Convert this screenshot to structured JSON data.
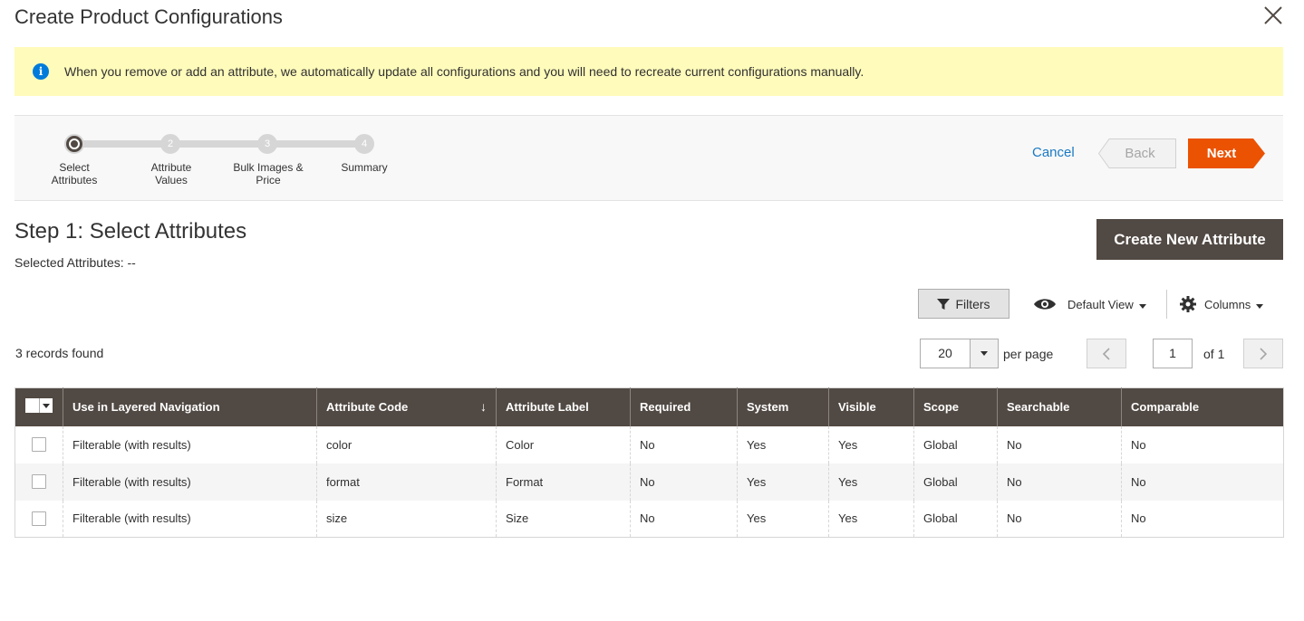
{
  "modal": {
    "title": "Create Product Configurations"
  },
  "notice": {
    "message": "When you remove or add an attribute, we automatically update all configurations and you will need to recreate current configurations manually."
  },
  "wizard": {
    "steps": [
      {
        "number": "",
        "label_line1": "Select",
        "label_line2": "Attributes"
      },
      {
        "number": "2",
        "label_line1": "Attribute",
        "label_line2": "Values"
      },
      {
        "number": "3",
        "label_line1": "Bulk Images &",
        "label_line2": "Price"
      },
      {
        "number": "4",
        "label_line1": "Summary",
        "label_line2": ""
      }
    ],
    "cancel_label": "Cancel",
    "back_label": "Back",
    "next_label": "Next"
  },
  "step": {
    "title": "Step 1: Select Attributes",
    "selected": "Selected Attributes: --",
    "create_button": "Create New Attribute"
  },
  "toolbar": {
    "filters_label": "Filters",
    "view_label": "Default View",
    "columns_label": "Columns",
    "records_found": "3 records found",
    "per_page_value": "20",
    "per_page_label": "per page",
    "current_page": "1",
    "page_of": "of 1"
  },
  "grid": {
    "columns": [
      "Use in Layered Navigation",
      "Attribute Code",
      "Attribute Label",
      "Required",
      "System",
      "Visible",
      "Scope",
      "Searchable",
      "Comparable"
    ],
    "sort_indicator": "↓",
    "rows": [
      [
        "Filterable (with results)",
        "color",
        "Color",
        "No",
        "Yes",
        "Yes",
        "Global",
        "No",
        "No"
      ],
      [
        "Filterable (with results)",
        "format",
        "Format",
        "No",
        "Yes",
        "Yes",
        "Global",
        "No",
        "No"
      ],
      [
        "Filterable (with results)",
        "size",
        "Size",
        "No",
        "Yes",
        "Yes",
        "Global",
        "No",
        "No"
      ]
    ]
  },
  "colors": {
    "accent_orange": "#eb5202",
    "header_dark": "#514943",
    "link_blue": "#1979c3",
    "notice_yellow": "#fffbbb",
    "info_blue": "#007bdb"
  },
  "icons": [
    "close-icon",
    "info-icon",
    "filter-icon",
    "eye-icon",
    "gear-icon",
    "chevron-left-icon",
    "chevron-right-icon",
    "caret-down-icon"
  ]
}
